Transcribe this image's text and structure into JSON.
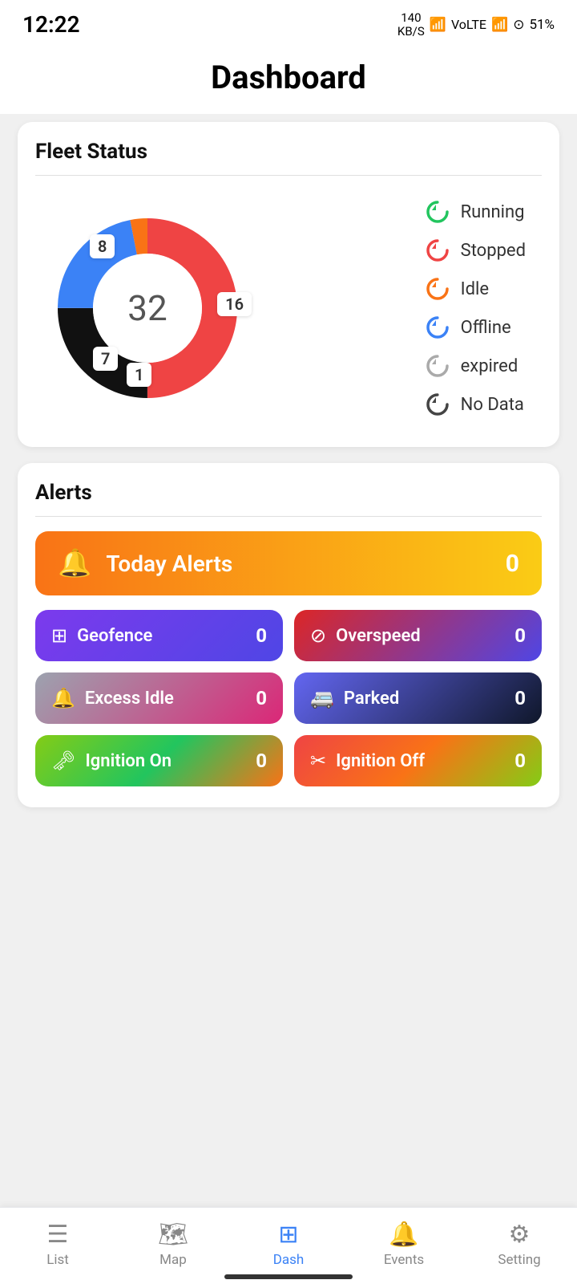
{
  "statusBar": {
    "time": "12:22",
    "data": "140\nKB/S",
    "battery": "51%"
  },
  "header": {
    "title": "Dashboard"
  },
  "fleetStatus": {
    "title": "Fleet Status",
    "total": "32",
    "segments": {
      "red": 16,
      "black": 8,
      "blue": 7,
      "orange": 1,
      "remaining": 0
    },
    "labels": {
      "top": "8",
      "right": "16",
      "bottomLeft": "7",
      "bottomCenter": "1"
    },
    "legend": [
      {
        "key": "running",
        "label": "Running",
        "color": "green"
      },
      {
        "key": "stopped",
        "label": "Stopped",
        "color": "red"
      },
      {
        "key": "idle",
        "label": "Idle",
        "color": "orange"
      },
      {
        "key": "offline",
        "label": "Offline",
        "color": "blue"
      },
      {
        "key": "expired",
        "label": "expired",
        "color": "gray"
      },
      {
        "key": "nodata",
        "label": "No Data",
        "color": "dark"
      }
    ]
  },
  "alerts": {
    "title": "Alerts",
    "today": {
      "label": "Today Alerts",
      "count": "0"
    },
    "items": [
      {
        "key": "geofence",
        "label": "Geofence",
        "count": "0",
        "icon": "⊞",
        "style": "ac-geofence"
      },
      {
        "key": "overspeed",
        "label": "Overspeed",
        "count": "0",
        "icon": "⊘",
        "style": "ac-overspeed"
      },
      {
        "key": "excess-idle",
        "label": "Excess Idle",
        "count": "0",
        "icon": "🔔",
        "style": "ac-excess"
      },
      {
        "key": "parked",
        "label": "Parked",
        "count": "0",
        "icon": "🚐",
        "style": "ac-parked"
      },
      {
        "key": "ignition-on",
        "label": "Ignition On",
        "count": "0",
        "icon": "🗝",
        "style": "ac-ignition-on"
      },
      {
        "key": "ignition-off",
        "label": "Ignition Off",
        "count": "0",
        "icon": "✂",
        "style": "ac-ignition-off"
      }
    ]
  },
  "bottomNav": {
    "items": [
      {
        "key": "list",
        "label": "List",
        "icon": "☰",
        "active": false
      },
      {
        "key": "map",
        "label": "Map",
        "icon": "🗺",
        "active": false
      },
      {
        "key": "dash",
        "label": "Dash",
        "icon": "⊞",
        "active": true
      },
      {
        "key": "events",
        "label": "Events",
        "icon": "🔔",
        "active": false
      },
      {
        "key": "setting",
        "label": "Setting",
        "icon": "⚙",
        "active": false
      }
    ]
  }
}
